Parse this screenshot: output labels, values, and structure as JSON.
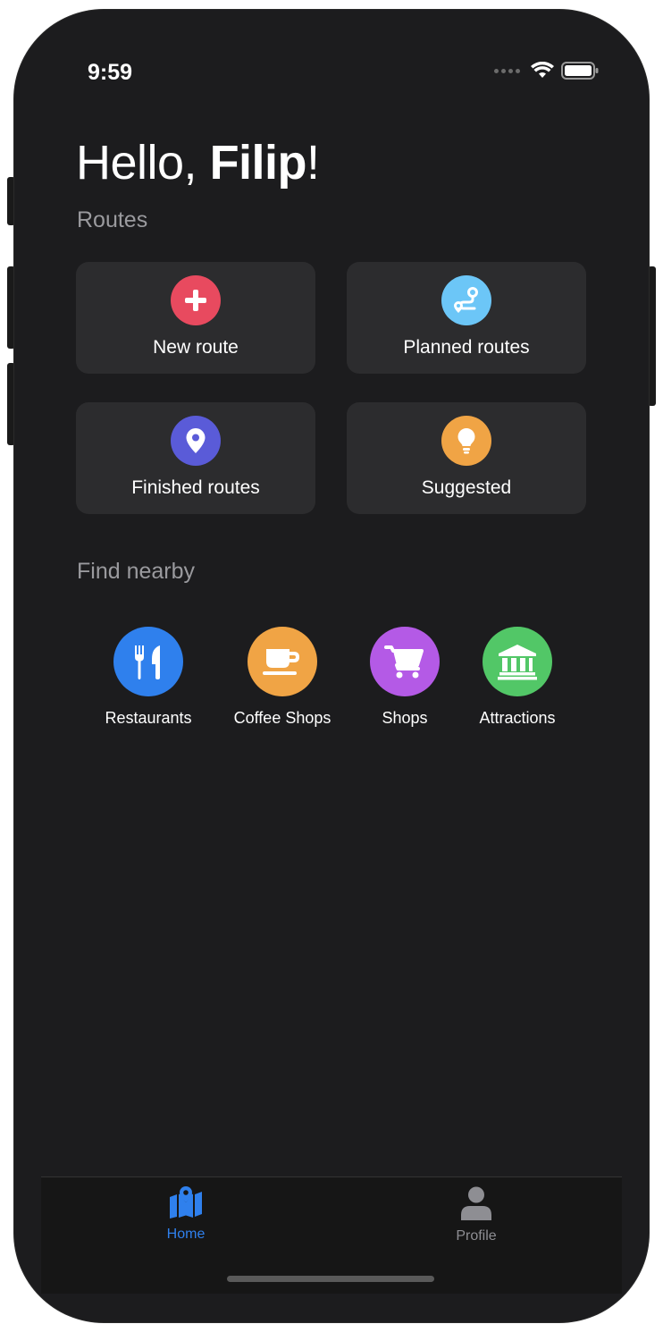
{
  "status_bar": {
    "time": "9:59"
  },
  "header": {
    "greeting_prefix": "Hello, ",
    "user_name": "Filip",
    "greeting_suffix": "!"
  },
  "routes_section": {
    "title": "Routes",
    "cards": [
      {
        "label": "New route",
        "icon": "plus-icon",
        "color": "#e84a5f"
      },
      {
        "label": "Planned routes",
        "icon": "route-icon",
        "color": "#6cc6f7"
      },
      {
        "label": "Finished routes",
        "icon": "location-pin-icon",
        "color": "#5a5bd8"
      },
      {
        "label": "Suggested",
        "icon": "lightbulb-icon",
        "color": "#f0a445"
      }
    ]
  },
  "nearby_section": {
    "title": "Find nearby",
    "items": [
      {
        "label": "Restaurants",
        "icon": "utensils-icon",
        "color": "#2f80ed"
      },
      {
        "label": "Coffee Shops",
        "icon": "coffee-icon",
        "color": "#f0a445"
      },
      {
        "label": "Shops",
        "icon": "cart-icon",
        "color": "#b45ae6"
      },
      {
        "label": "Attractions",
        "icon": "landmark-icon",
        "color": "#52c767"
      }
    ]
  },
  "tab_bar": {
    "tabs": [
      {
        "label": "Home",
        "icon": "map-icon",
        "active": true,
        "color": "#2f80ed"
      },
      {
        "label": "Profile",
        "icon": "user-icon",
        "active": false,
        "color": "#8e8e93"
      }
    ]
  }
}
